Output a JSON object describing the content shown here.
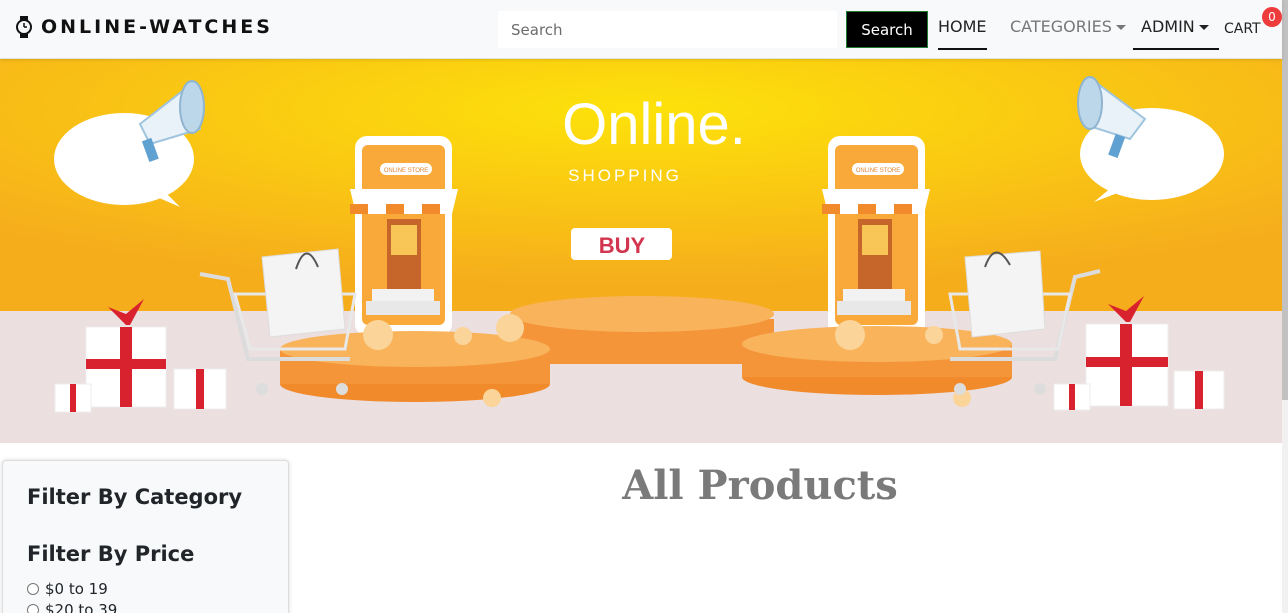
{
  "brand": {
    "name": "ONLINE-WATCHES",
    "icon": "watch-icon"
  },
  "search": {
    "placeholder": "Search",
    "button_label": "Search"
  },
  "nav": {
    "home": "HOME",
    "categories": "CATEGORIES",
    "admin": "ADMIN",
    "cart": "CART",
    "cart_count": "0"
  },
  "banner": {
    "headline": "Online.",
    "subline": "SHOPPING",
    "buy_label": "BUY",
    "store_sign": "ONLINE STORE"
  },
  "sidebar": {
    "filter_category_title": "Filter By Category",
    "filter_price_title": "Filter By Price",
    "price_options": [
      "$0 to 19",
      "$20 to 39"
    ]
  },
  "main": {
    "heading": "All Products"
  },
  "colors": {
    "accent": "#000000",
    "badge": "#ee3b3b",
    "banner_yellow": "#f9c70e",
    "banner_orange": "#f7a33a"
  }
}
